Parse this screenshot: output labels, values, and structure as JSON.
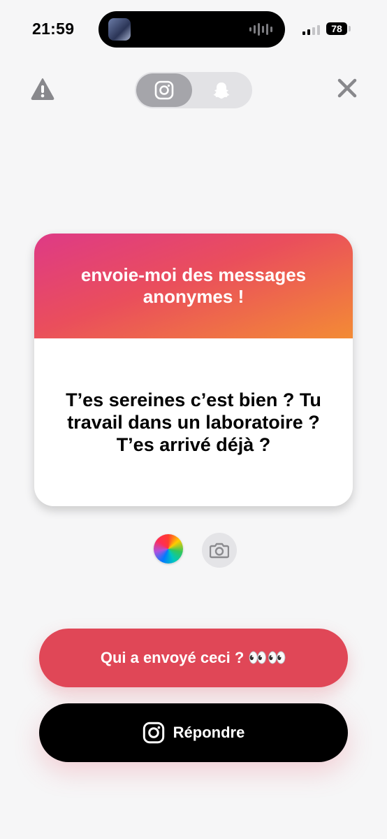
{
  "status_bar": {
    "time": "21:59",
    "battery": "78"
  },
  "top_bar": {
    "warning_icon": "warning-triangle-icon",
    "tabs": [
      {
        "name": "instagram",
        "icon": "instagram-icon",
        "selected": true
      },
      {
        "name": "snapchat",
        "icon": "snapchat-ghost-icon",
        "selected": false
      }
    ],
    "close_icon": "close-x-icon"
  },
  "card": {
    "header": "envoie-moi des messages anonymes !",
    "message": "T’es sereines c’est bien ? Tu travail dans un laboratoire ? T’es arrivé déjà ?"
  },
  "tools": {
    "color_icon": "color-wheel-icon",
    "camera_icon": "camera-icon"
  },
  "actions": {
    "who_sent": "Qui a envoyé ceci ? 👀👀",
    "reply": "Répondre"
  },
  "colors": {
    "gradient_start": "#de3a86",
    "gradient_end": "#f38b35",
    "who_button": "#e04757",
    "reply_button": "#000000"
  }
}
